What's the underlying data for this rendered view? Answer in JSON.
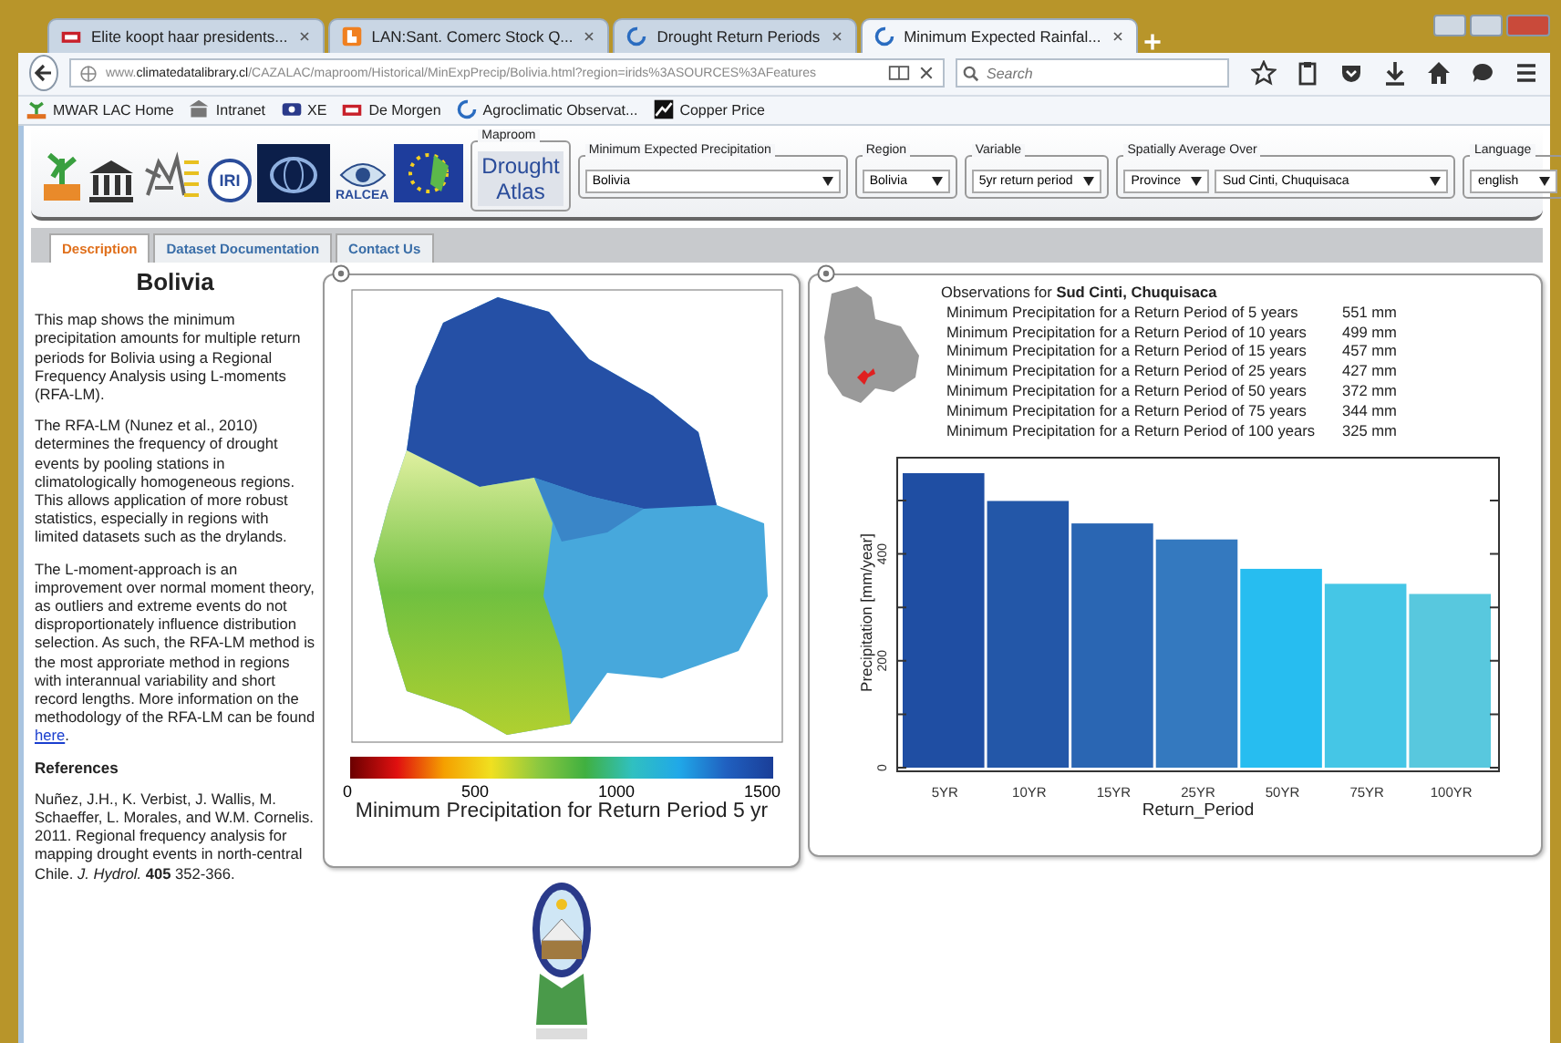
{
  "browser": {
    "tabs": [
      {
        "title": "Elite koopt haar presidents...",
        "kind": "news",
        "selected": false
      },
      {
        "title": "LAN:Sant. Comerc Stock Q...",
        "kind": "blog",
        "selected": false
      },
      {
        "title": "Drought Return Periods",
        "kind": "loading",
        "selected": false
      },
      {
        "title": "Minimum Expected Rainfal...",
        "kind": "loading",
        "selected": true
      }
    ],
    "url": "www.**climatedatalibrary.cl**/CAZALAC/maproom/Historical/MinExpPrecip/Bolivia.html?region=irids%3ASOURCES%3AFeatures",
    "search_placeholder": "Search",
    "bookmarks": [
      {
        "label": "MWAR LAC Home",
        "kind": "sprout"
      },
      {
        "label": "Intranet",
        "kind": "building"
      },
      {
        "label": "XE",
        "kind": "xe"
      },
      {
        "label": "De Morgen",
        "kind": "news"
      },
      {
        "label": "Agroclimatic Observat...",
        "kind": "loading"
      },
      {
        "label": "Copper Price",
        "kind": "chart"
      }
    ]
  },
  "header": {
    "logos": [
      {
        "kind": "sprout"
      },
      {
        "kind": "temple"
      },
      {
        "kind": "lion"
      },
      {
        "kind": "circle",
        "text": "IRI"
      },
      {
        "kind": "globe"
      },
      {
        "kind": "eye",
        "text": "RALCEA"
      },
      {
        "kind": "stars"
      }
    ],
    "controls": [
      {
        "legend": "Maproom",
        "kind": "button",
        "values": [
          "Drought Atlas"
        ]
      },
      {
        "legend": "Minimum Expected Precipitation",
        "kind": "select",
        "values": [
          "Bolivia"
        ]
      },
      {
        "legend": "Region",
        "kind": "select",
        "values": [
          "Bolivia"
        ]
      },
      {
        "legend": "Variable",
        "kind": "select",
        "values": [
          "5yr return period"
        ]
      },
      {
        "legend": "Spatially Average Over",
        "kind": "select",
        "values": [
          "Province",
          "Sud Cinti, Chuquisaca"
        ]
      },
      {
        "legend": "Language",
        "kind": "select",
        "values": [
          "english"
        ]
      }
    ]
  },
  "page_tabs": [
    {
      "label": "Description",
      "selected": true
    },
    {
      "label": "Dataset Documentation",
      "selected": false
    },
    {
      "label": "Contact Us",
      "selected": false
    }
  ],
  "description": {
    "title": "Bolivia",
    "paragraphs": [
      {
        "text": "This map shows the minimum precipitation amounts for multiple return periods for Bolivia using a Regional Frequency Analysis using L-moments (RFA-LM)."
      },
      {
        "text": "The RFA-LM (Nunez et al., 2010) determines the frequency of drought events by pooling stations in climatologically homogeneous regions. This allows application of more robust statistics, especially in regions with limited datasets such as the drylands."
      },
      {
        "text": "The L-moment-approach is an improvement over normal moment theory, as outliers and extreme events do not disproportionately influence distribution selection. As such, the RFA-LM method is the most approriate method in regions with interannual variability and short record lengths. More information on the methodology of the RFA-LM can be found ",
        "link": "here",
        "after": "."
      }
    ],
    "references_heading": "References",
    "reference": "Nuñez, J.H., K. Verbist, J. Wallis, M. Schaeffer, L. Morales, and W.M. Cornelis. 2011. Regional frequency analysis for mapping drought events in north-central Chile. *J. Hydrol.* **405** 352-366."
  },
  "map_panel": {
    "colorbar": {
      "ticks": [
        "0",
        "500",
        "1000",
        "1500"
      ],
      "title": "Minimum  Precipitation for Return Period 5 yr"
    }
  },
  "observations": {
    "heading": "Observations for **Sud Cinti, Chuquisaca**",
    "rows": [
      {
        "label": "Minimum Precipitation for a Return Period of 5 years",
        "value": "551 mm"
      },
      {
        "label": "Minimum Precipitation for a Return Period of 10 years",
        "value": "499 mm"
      },
      {
        "label": "Minimum Precipitation for a Return Period of 15 years",
        "value": "457 mm"
      },
      {
        "label": "Minimum Precipitation for a Return Period of 25 years",
        "value": "427 mm"
      },
      {
        "label": "Minimum Precipitation for a Return Period of 50 years",
        "value": "372 mm"
      },
      {
        "label": "Minimum Precipitation for a Return Period of 75 years",
        "value": "344 mm"
      },
      {
        "label": "Minimum Precipitation for a Return Period of 100 years",
        "value": "325 mm"
      }
    ],
    "chart_data": {
      "type": "bar",
      "xlabel": "Return_Period",
      "ylabel": "Precipitation [mm/year]",
      "categories": [
        "5YR",
        "10YR",
        "15YR",
        "25YR",
        "50YR",
        "75YR",
        "100YR"
      ],
      "series": [
        {
          "values": [
            551,
            499,
            457,
            427,
            372,
            344,
            325
          ]
        }
      ],
      "ylim": [
        0,
        580
      ],
      "yticks": [
        0,
        200,
        400
      ]
    }
  }
}
